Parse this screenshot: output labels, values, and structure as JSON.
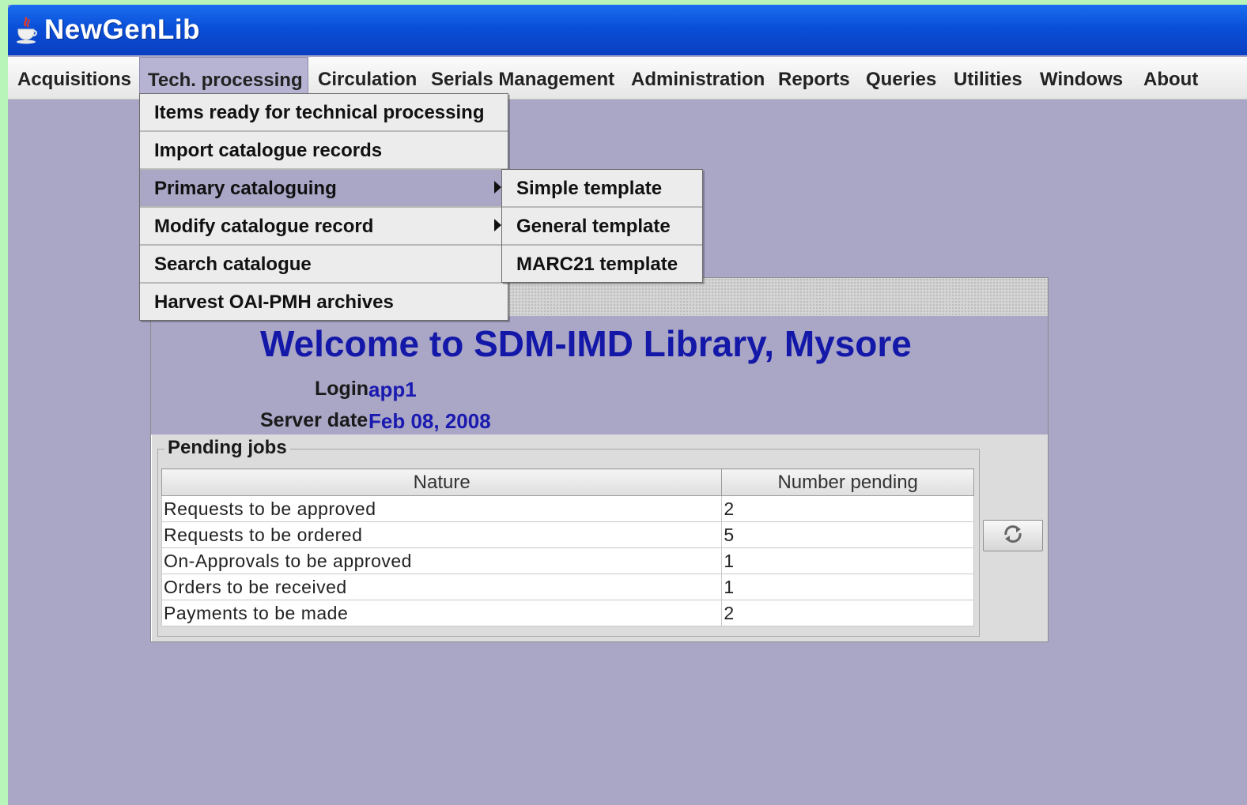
{
  "window": {
    "title": "NewGenLib",
    "icon": "java-cup-icon"
  },
  "menubar": {
    "items": [
      {
        "label": "Acquisitions"
      },
      {
        "label": "Tech. processing"
      },
      {
        "label": "Circulation"
      },
      {
        "label": "Serials Management"
      },
      {
        "label": "Administration"
      },
      {
        "label": "Reports"
      },
      {
        "label": "Queries"
      },
      {
        "label": "Utilities"
      },
      {
        "label": "Windows"
      },
      {
        "label": "About"
      }
    ],
    "active": "Tech. processing"
  },
  "tech_menu": {
    "items": [
      {
        "label": "Items ready for technical processing"
      },
      {
        "label": "Import catalogue records"
      },
      {
        "label": "Primary cataloguing"
      },
      {
        "label": "Modify catalogue record"
      },
      {
        "label": "Search catalogue"
      },
      {
        "label": "Harvest OAI-PMH archives"
      }
    ],
    "selected": "Primary cataloguing"
  },
  "submenu": {
    "items": [
      {
        "label": "Simple template"
      },
      {
        "label": "General template"
      },
      {
        "label": "MARC21 template"
      }
    ]
  },
  "welcome": {
    "title": "Welcome to SDM-IMD Library, Mysore",
    "login_label": "Login",
    "login_value": "app1",
    "server_date_label": "Server date",
    "server_date_value": "Feb 08, 2008"
  },
  "pending_jobs": {
    "legend": "Pending jobs",
    "columns": [
      "Nature",
      "Number pending"
    ],
    "rows": [
      {
        "nature": "Requests to be approved",
        "count": "2"
      },
      {
        "nature": "Requests to be ordered",
        "count": "5"
      },
      {
        "nature": "On-Approvals to be approved",
        "count": "1"
      },
      {
        "nature": "Orders to be received",
        "count": "1"
      },
      {
        "nature": "Payments to be made",
        "count": "2"
      }
    ],
    "refresh_icon": "refresh-icon"
  },
  "colors": {
    "desktop": "#a9a6c6",
    "titlebar": "#0a4fd8",
    "welcome_text": "#1418a8"
  }
}
